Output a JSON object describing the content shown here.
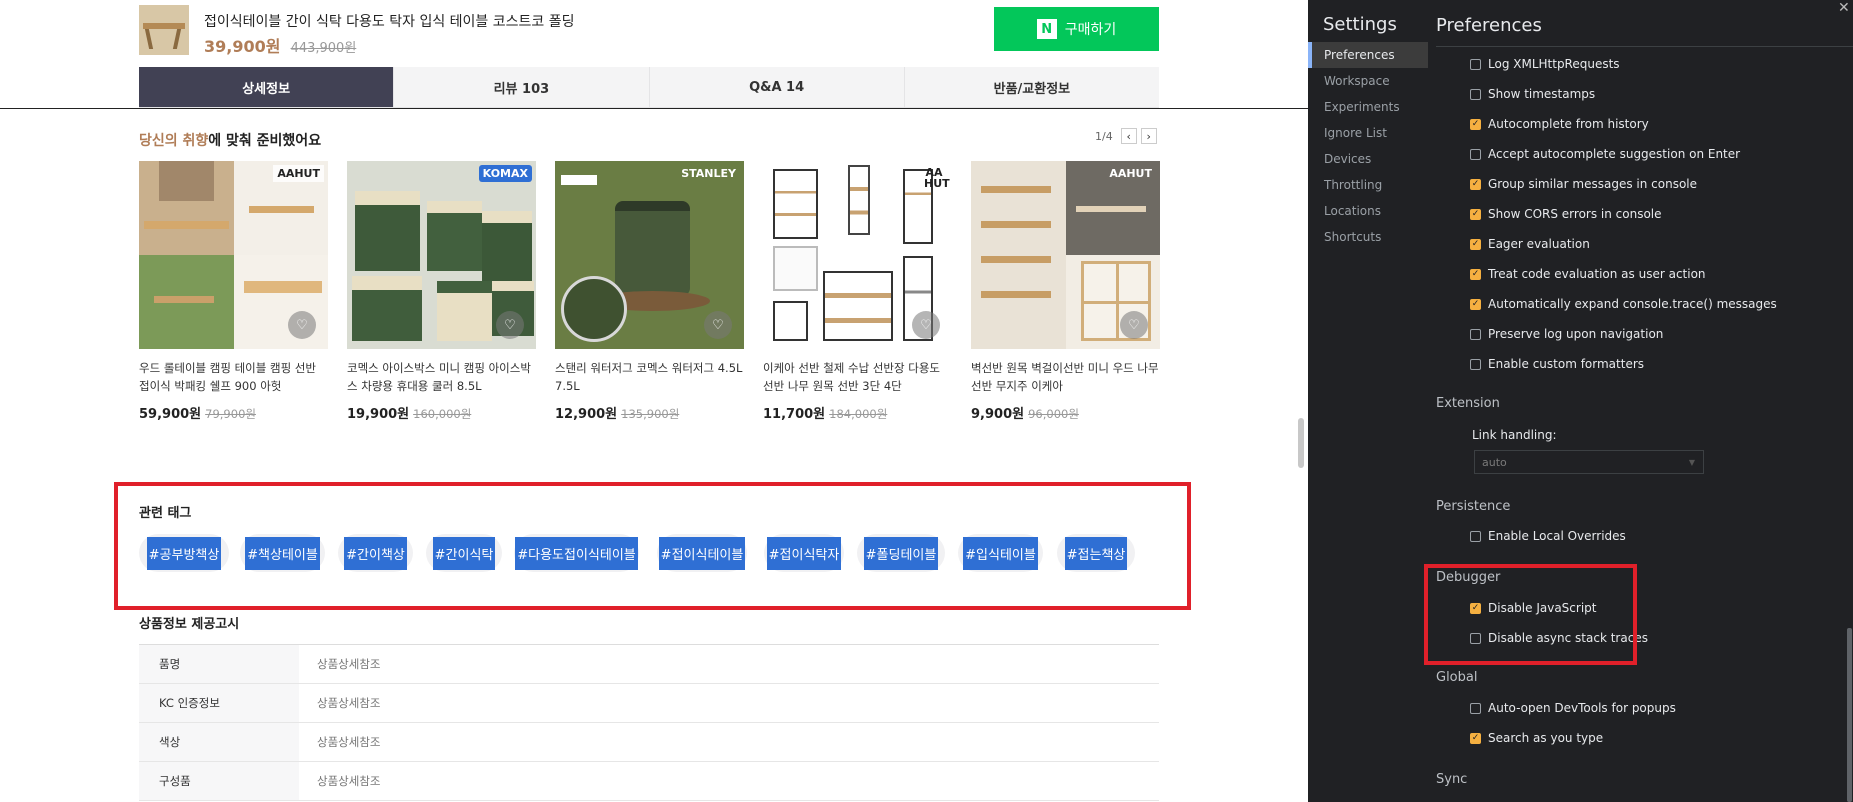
{
  "product": {
    "title": "접이식테이블 간이 식탁 다용도 탁자 입식 테이블 코스트코 폴딩",
    "price": "39,900원",
    "original_price": "443,900원",
    "buy_label": "구매하기",
    "naver_logo": "N"
  },
  "tabs": [
    "상세정보",
    "리뷰 103",
    "Q&A 14",
    "반품/교환정보"
  ],
  "recommend": {
    "title_highlight": "당신의 취향",
    "title_rest": "에 맞춰 준비했어요",
    "pager_count": "1/4",
    "prev_icon": "‹",
    "next_icon": "›",
    "items": [
      {
        "brand": "AAHUT",
        "name": "우드 롤테이블 캠핑 테이블 캠핑 선반 접이식 박패킹 쉘프 900 아헛",
        "price": "59,900원",
        "original": "79,900원"
      },
      {
        "brand": "KOMAX",
        "name": "코멕스 아이스박스 미니 캠핑 아이스박스 차량용 휴대용 쿨러 8.5L",
        "price": "19,900원",
        "original": "160,000원"
      },
      {
        "brand": "STANLEY",
        "name": "스탠리 워터저그 코멕스 워터저그 4.5L 7.5L",
        "price": "12,900원",
        "original": "135,900원"
      },
      {
        "brand": "AA HUT",
        "name": "이케아 선반 철제 수납 선반장 다용도 선반 나무 원목 선반 3단 4단",
        "price": "11,700원",
        "original": "184,000원"
      },
      {
        "brand": "AAHUT",
        "name": "벽선반 원목 벽걸이선반 미니 우드 나무 선반 무지주 이케아",
        "price": "9,900원",
        "original": "96,000원"
      }
    ]
  },
  "related_tags": {
    "title": "관련 태그",
    "items": [
      "#공부방책상",
      "#책상테이블",
      "#간이책상",
      "#간이식탁",
      "#다용도접이식테이블",
      "#접이식테이블",
      "#접이식탁자",
      "#폴딩테이블",
      "#입식테이블",
      "#접는책상"
    ]
  },
  "product_notice": {
    "title": "상품정보 제공고시",
    "rows": [
      {
        "key": "품명",
        "value": "상품상세참조"
      },
      {
        "key": "KC 인증정보",
        "value": "상품상세참조"
      },
      {
        "key": "색상",
        "value": "상품상세참조"
      },
      {
        "key": "구성품",
        "value": "상품상세참조"
      }
    ]
  },
  "devtools": {
    "close_icon": "✕",
    "settings_title": "Settings",
    "preferences_title": "Preferences",
    "nav": [
      "Preferences",
      "Workspace",
      "Experiments",
      "Ignore List",
      "Devices",
      "Throttling",
      "Locations",
      "Shortcuts"
    ],
    "console_options": [
      {
        "label": "Log XMLHttpRequests",
        "checked": false
      },
      {
        "label": "Show timestamps",
        "checked": false
      },
      {
        "label": "Autocomplete from history",
        "checked": true
      },
      {
        "label": "Accept autocomplete suggestion on Enter",
        "checked": false
      },
      {
        "label": "Group similar messages in console",
        "checked": true
      },
      {
        "label": "Show CORS errors in console",
        "checked": true
      },
      {
        "label": "Eager evaluation",
        "checked": true
      },
      {
        "label": "Treat code evaluation as user action",
        "checked": true
      },
      {
        "label": "Automatically expand console.trace() messages",
        "checked": true
      },
      {
        "label": "Preserve log upon navigation",
        "checked": false
      },
      {
        "label": "Enable custom formatters",
        "checked": false
      }
    ],
    "extension": {
      "title": "Extension",
      "link_handling_label": "Link handling:",
      "link_handling_value": "auto"
    },
    "persistence": {
      "title": "Persistence",
      "options": [
        {
          "label": "Enable Local Overrides",
          "checked": false
        }
      ]
    },
    "debugger": {
      "title": "Debugger",
      "options": [
        {
          "label": "Disable JavaScript",
          "checked": true
        },
        {
          "label": "Disable async stack traces",
          "checked": false
        }
      ]
    },
    "global": {
      "title": "Global",
      "options": [
        {
          "label": "Auto-open DevTools for popups",
          "checked": false
        },
        {
          "label": "Search as you type",
          "checked": true
        }
      ]
    },
    "sync": {
      "title": "Sync"
    }
  },
  "colors": {
    "accent_green": "#03c75a",
    "price_brown": "#b07d57",
    "tag_blue": "#2f6fd4",
    "highlight_red": "#e0202a",
    "checkbox_orange": "#f5b041"
  }
}
